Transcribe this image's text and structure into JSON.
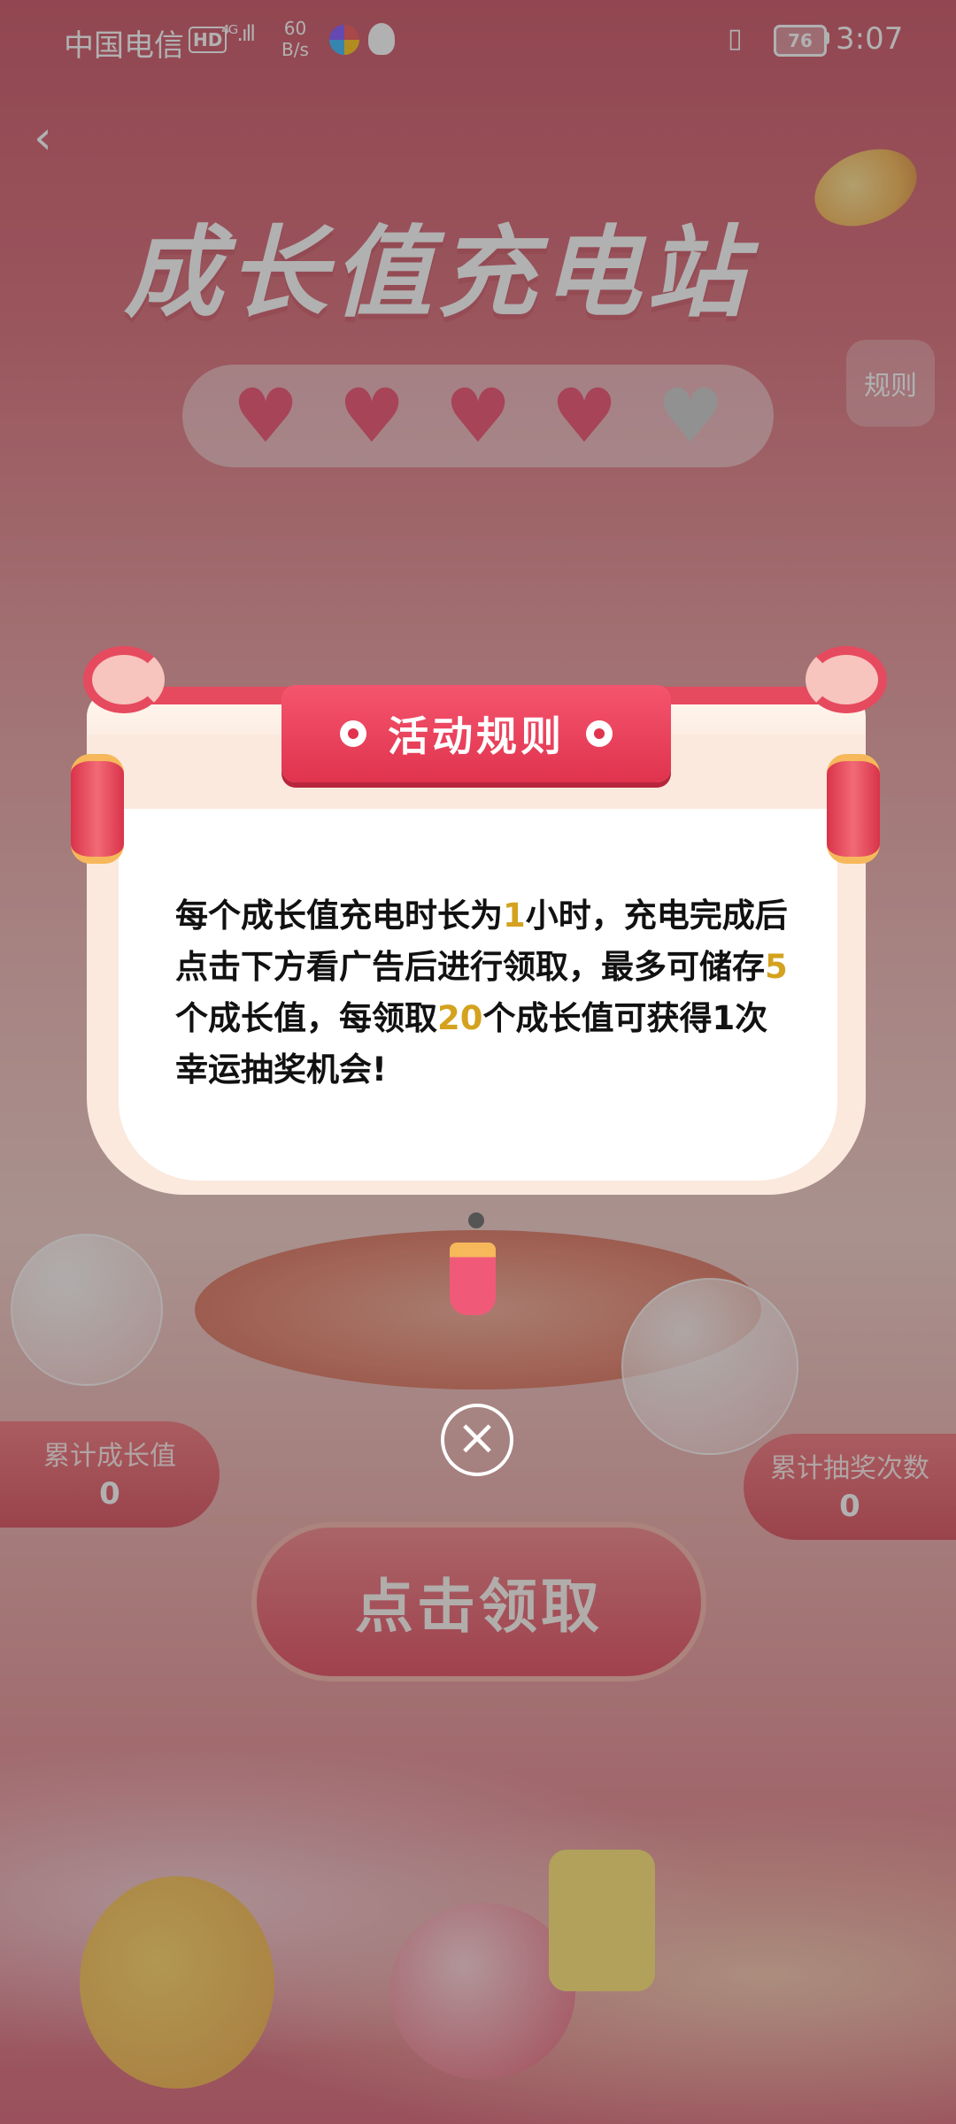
{
  "status_bar": {
    "carrier": "中国电信",
    "hd": "HD",
    "signal": "⁴ᴳ.ıll",
    "net_speed_value": "60",
    "net_speed_unit": "B/s",
    "battery": "76",
    "time": "3:07"
  },
  "header": {
    "back": "‹",
    "title": "成长值充电站",
    "rules_button": "规则"
  },
  "hearts": {
    "filled": 4,
    "total": 5
  },
  "stats": {
    "left_label": "累计成长值",
    "left_value": "0",
    "right_label": "累计抽奖次数",
    "right_value": "0"
  },
  "claim_button": "点击领取",
  "modal": {
    "title": "活动规则",
    "rules": {
      "p1": "每个成长值充电时长为",
      "h1": "1",
      "p2": "小时，充电完成后点击下方看广告后进行领取，最多可储存",
      "h2": "5",
      "p3": "个成长值，每领取",
      "h3": "20",
      "p4": "个成长值可获得1次幸运抽奖机会!"
    },
    "close": "×"
  },
  "colors": {
    "highlight": "#d4a21f",
    "ribbon": "#e0334e",
    "background": "#d8616e"
  }
}
